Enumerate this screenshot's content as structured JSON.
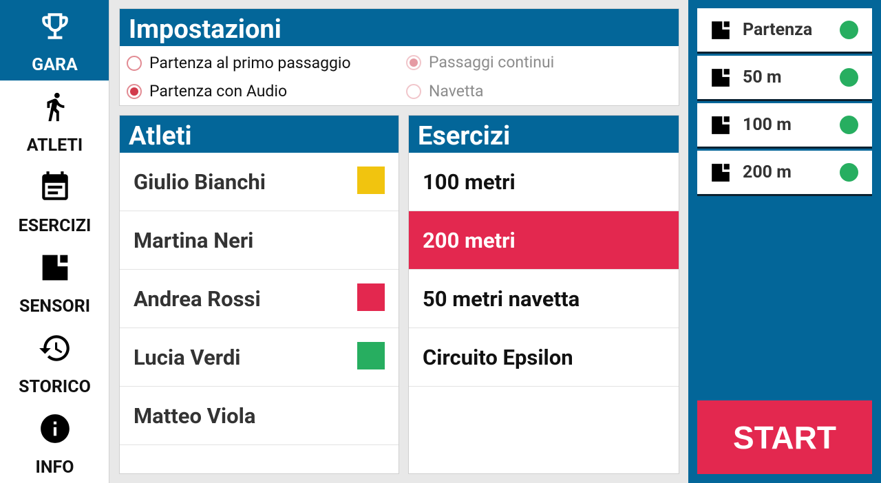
{
  "nav": {
    "items": [
      {
        "label": "GARA",
        "icon": "trophy-icon"
      },
      {
        "label": "ATLETI",
        "icon": "runner-icon"
      },
      {
        "label": "ESERCIZI",
        "icon": "calendar-icon"
      },
      {
        "label": "SENSORI",
        "icon": "sensor-icon"
      },
      {
        "label": "STORICO",
        "icon": "history-icon"
      },
      {
        "label": "INFO",
        "icon": "info-icon"
      }
    ],
    "active_color": "#036699"
  },
  "settings": {
    "title": "Impostazioni",
    "options": [
      {
        "label": "Partenza al primo passaggio",
        "checked": false,
        "disabled": false
      },
      {
        "label": "Partenza con Audio",
        "checked": true,
        "disabled": false
      },
      {
        "label": "Passaggi continui",
        "checked": true,
        "disabled": true
      },
      {
        "label": "Navetta",
        "checked": false,
        "disabled": true
      }
    ]
  },
  "athletes": {
    "title": "Atleti",
    "rows": [
      {
        "name": "Giulio Bianchi",
        "color": "#f1c40f"
      },
      {
        "name": "Martina Neri",
        "color": null
      },
      {
        "name": "Andrea Rossi",
        "color": "#e3284f"
      },
      {
        "name": "Lucia Verdi",
        "color": "#27ae60"
      },
      {
        "name": "Matteo Viola",
        "color": null
      }
    ]
  },
  "exercises": {
    "title": "Esercizi",
    "rows": [
      {
        "name": "100 metri",
        "selected": false
      },
      {
        "name": "200 metri",
        "selected": true
      },
      {
        "name": "50 metri navetta",
        "selected": false
      },
      {
        "name": "Circuito Epsilon",
        "selected": false
      }
    ]
  },
  "sensors": [
    {
      "name": "Partenza",
      "status_color": "#27ae60"
    },
    {
      "name": "50 m",
      "status_color": "#27ae60"
    },
    {
      "name": "100 m",
      "status_color": "#27ae60"
    },
    {
      "name": "200 m",
      "status_color": "#27ae60"
    }
  ],
  "start_label": "START",
  "colors": {
    "primary": "#036699",
    "accent": "#e3284f",
    "ok": "#27ae60"
  }
}
